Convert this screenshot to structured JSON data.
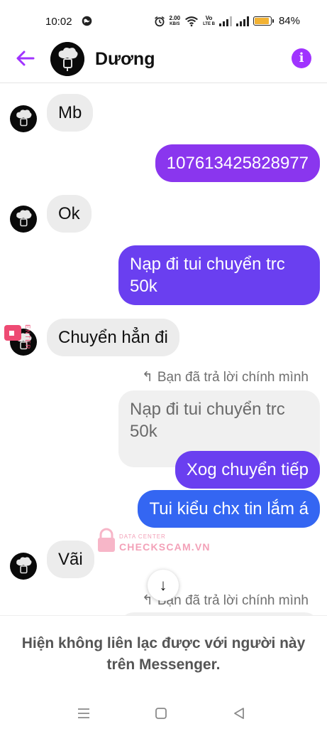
{
  "status_bar": {
    "time": "10:02",
    "net_speed_top": "2.00",
    "net_speed_bottom": "KB/S",
    "volte_top": "Vo",
    "volte_bottom": "LTE B",
    "battery_percent": "84%",
    "battery_level": 0.84
  },
  "header": {
    "contact_name": "Dương",
    "accent_color": "#a033ff"
  },
  "messages": [
    {
      "from": "them",
      "text": "Mb"
    },
    {
      "from": "me",
      "text": "107613425828977"
    },
    {
      "from": "them",
      "text": "Ok"
    },
    {
      "from": "me",
      "text": "Nạp đi tui chuyển trc 50k"
    },
    {
      "from": "them",
      "text": "Chuyển hẳn đi"
    },
    {
      "from": "me",
      "reply_label": "Bạn đã trả lời chính mình",
      "quoted": "Nạp đi tui chuyển trc 50k"
    },
    {
      "from": "me",
      "text": "Xog chuyển tiếp"
    },
    {
      "from": "me",
      "text": "Tui kiểu chx tin lắm á"
    },
    {
      "from": "them",
      "text": "Vãi"
    },
    {
      "from": "me",
      "reply_label": "Bạn đã trả lời chính mình"
    }
  ],
  "watermark": {
    "line1": "DATA CENTER",
    "line2": "CHECKSCAM.VN"
  },
  "footer": {
    "notice": "Hiện không liên lạc được với người này trên Messenger."
  },
  "icons": {
    "back": "arrow-left-icon",
    "info": "info-icon",
    "scroll": "arrow-down-icon",
    "nav_menu": "menu-icon",
    "nav_home": "square-icon",
    "nav_back": "triangle-back-icon"
  }
}
